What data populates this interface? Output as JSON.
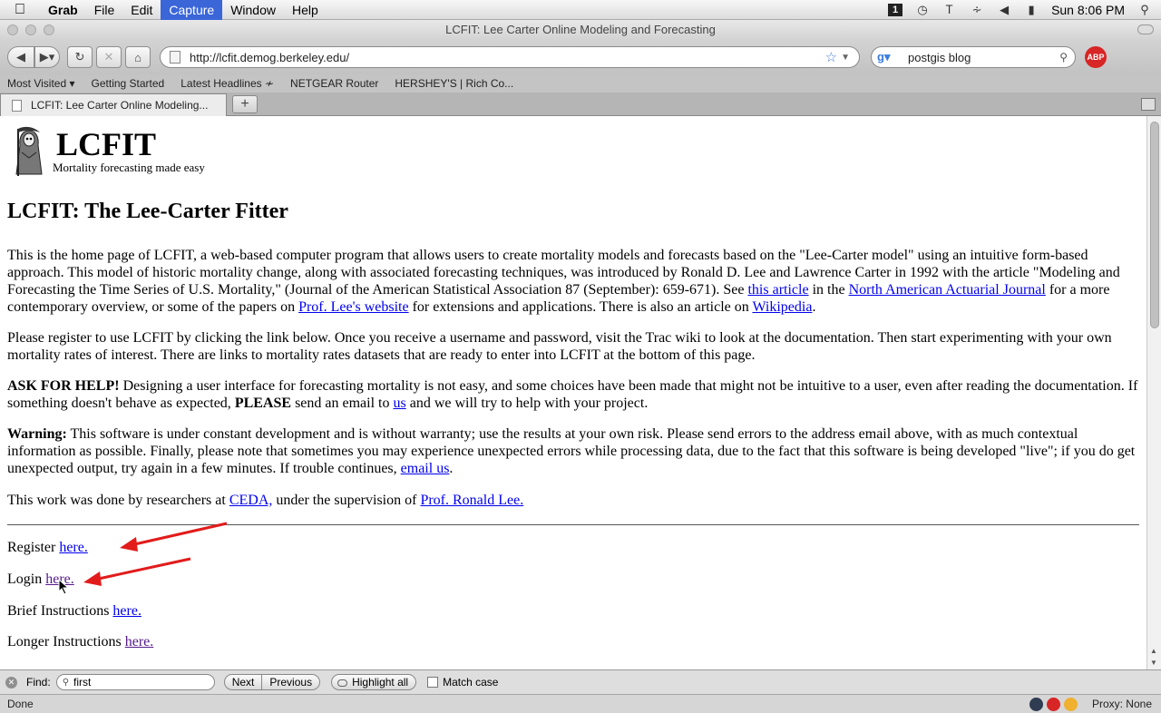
{
  "menubar": {
    "app_name": "Grab",
    "items": [
      "File",
      "Edit",
      "Capture",
      "Window",
      "Help"
    ],
    "clock": "Sun 8:06 PM"
  },
  "window": {
    "title": "LCFIT: Lee Carter Online Modeling and Forecasting"
  },
  "navbar": {
    "url": "http://lcfit.demog.berkeley.edu/",
    "search_value": "postgis blog",
    "adblock_label": "ABP"
  },
  "bookmarks": [
    "Most Visited",
    "Getting Started",
    "Latest Headlines",
    "NETGEAR Router",
    "HERSHEY'S | Rich Co..."
  ],
  "tab": {
    "label": "LCFIT: Lee Carter Online Modeling..."
  },
  "page": {
    "logo_title": "LCFIT",
    "logo_tagline": "Mortality forecasting made easy",
    "heading": "LCFIT: The Lee-Carter Fitter",
    "p1_a": "This is the home page of LCFIT, a web-based computer program that allows users to create mortality models and forecasts based on the \"Lee-Carter model\" using an intuitive form-based approach. This model of historic mortality change, along with associated forecasting techniques, was introduced by Ronald D. Lee and Lawrence Carter in 1992 with the article \"Modeling and Forecasting the Time Series of U.S. Mortality,\" (Journal of the American Statistical Association 87 (September): 659-671). See ",
    "p1_link_article": "this article",
    "p1_b": " in the ",
    "p1_link_naaj": "North American Actuarial Journal",
    "p1_c": " for a more contemporary overview, or some of the papers on ",
    "p1_link_lee": "Prof. Lee's website",
    "p1_d": " for extensions and applications. There is also an article on ",
    "p1_link_wiki": "Wikipedia",
    "p1_e": ".",
    "p2": "Please register to use LCFIT by clicking the link below. Once you receive a username and password, visit the Trac wiki to look at the documentation. Then start experimenting with your own mortality rates of interest. There are links to mortality rates datasets that are ready to enter into LCFIT at the bottom of this page.",
    "p3_bold": "ASK FOR HELP!",
    "p3_a": " Designing a user interface for forecasting mortality is not easy, and some choices have been made that might not be intuitive to a user, even after reading the documentation. If something doesn't behave as expected, ",
    "p3_bold2": "PLEASE",
    "p3_b": " send an email to ",
    "p3_link_us": "us",
    "p3_c": " and we will try to help with your project.",
    "p4_bold": "Warning:",
    "p4_a": " This software is under constant development and is without warranty; use the results at your own risk. Please send errors to the address email above, with as much contextual information as possible. Finally, please note that sometimes you may experience unexpected errors while processing data, due to the fact that this software is being developed \"live\"; if you do get unexpected output, try again in a few minutes. If trouble continues, ",
    "p4_link_email": "email us",
    "p4_b": ".",
    "p5_a": "This work was done by researchers at ",
    "p5_link_ceda": "CEDA,",
    "p5_b": " under the supervision of ",
    "p5_link_lee": "Prof. Ronald Lee.",
    "register_label": "Register ",
    "register_link": "here.",
    "login_label": "Login ",
    "login_link": "here.",
    "brief_label": "Brief Instructions ",
    "brief_link": "here.",
    "longer_label": "Longer Instructions ",
    "longer_link": "here."
  },
  "findbar": {
    "label": "Find:",
    "value": "first",
    "next": "Next",
    "previous": "Previous",
    "highlight": "Highlight all",
    "match_case": "Match case"
  },
  "statusbar": {
    "status": "Done",
    "proxy": "Proxy: None"
  }
}
